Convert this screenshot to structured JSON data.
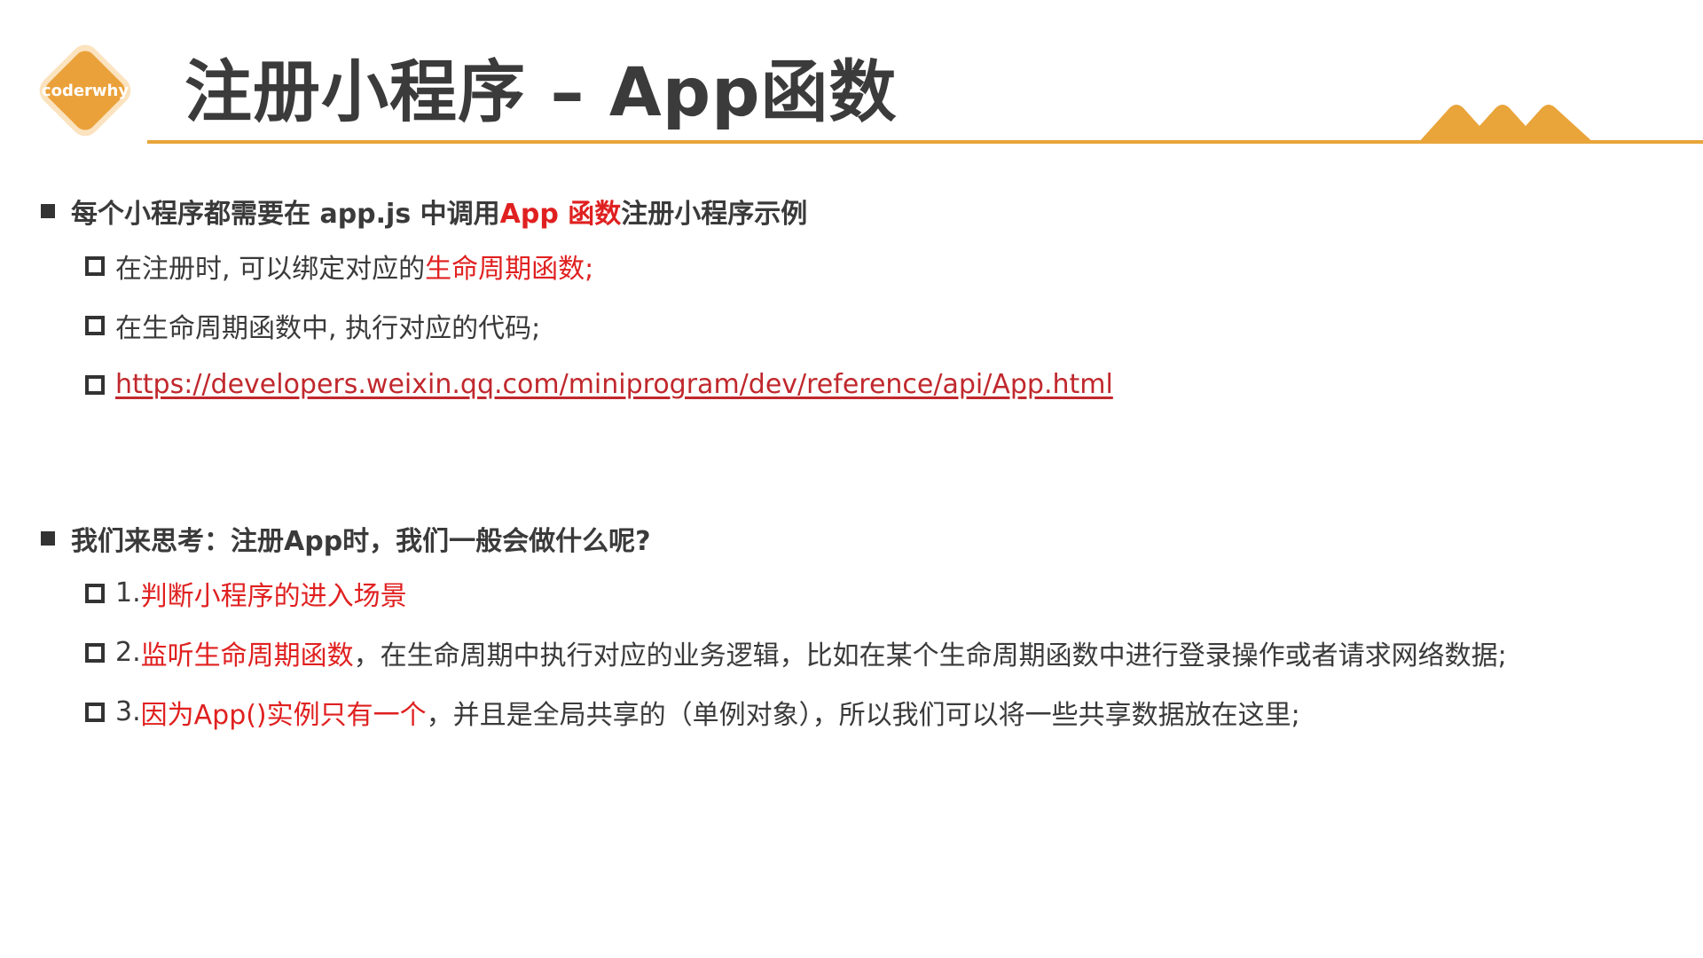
{
  "colors": {
    "accent": "#e9a43a",
    "emphasis": "#e02020",
    "text": "#3a3a3a"
  },
  "logo": {
    "text": "coderwhy",
    "icon": "orange-diamond-logo"
  },
  "header": {
    "title": "注册小程序 – App函数"
  },
  "section1": {
    "heading_prefix": "每个小程序都需要在 app.js 中调用 ",
    "heading_emphasis": "App 函数",
    "heading_suffix": " 注册小程序示例",
    "items": [
      {
        "prefix": "在注册时, 可以绑定对应的",
        "emphasis": "生命周期函数;"
      },
      {
        "text": "在生命周期函数中, 执行对应的代码;"
      },
      {
        "link": "https://developers.weixin.qq.com/miniprogram/dev/reference/api/App.html"
      }
    ]
  },
  "section2": {
    "heading": "我们来思考：注册App时，我们一般会做什么呢?",
    "items": [
      {
        "number": "1. ",
        "emphasis": "判断小程序的进入场景",
        "rest": ""
      },
      {
        "number": "2. ",
        "emphasis": "监听生命周期函数",
        "rest": "，在生命周期中执行对应的业务逻辑，比如在某个生命周期函数中进行登录操作或者请求网络数据;"
      },
      {
        "number": "3. ",
        "emphasis": "因为App()实例只有一个",
        "rest": "，并且是全局共享的（单例对象），所以我们可以将一些共享数据放在这里;"
      }
    ]
  }
}
